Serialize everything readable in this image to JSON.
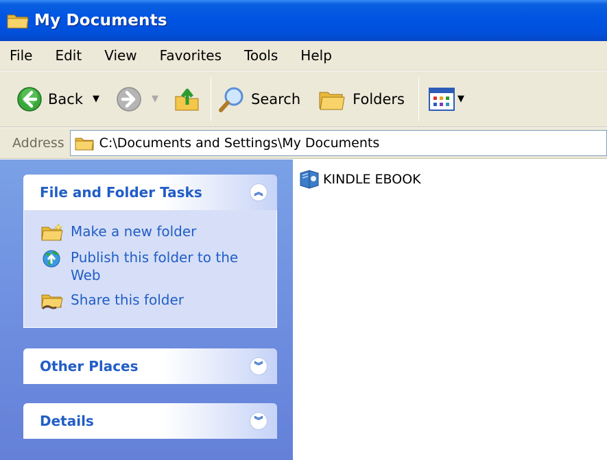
{
  "window": {
    "title": "My Documents"
  },
  "menu": {
    "items": [
      "File",
      "Edit",
      "View",
      "Favorites",
      "Tools",
      "Help"
    ]
  },
  "toolbar": {
    "back": "Back",
    "search": "Search",
    "folders": "Folders"
  },
  "address": {
    "label": "Address",
    "path": "C:\\Documents and Settings\\My Documents"
  },
  "tasks": {
    "title": "File and Folder Tasks",
    "items": [
      "Make a new folder",
      "Publish this folder to the Web",
      "Share this folder"
    ]
  },
  "other_places": {
    "title": "Other Places"
  },
  "details": {
    "title": "Details"
  },
  "files": [
    {
      "name": "KINDLE EBOOK",
      "icon": "ebook-icon"
    }
  ],
  "colors": {
    "titlebar": "#0054e3",
    "taskpane": "#6f8fe0",
    "link": "#215dc6",
    "chrome": "#ece9d8"
  }
}
